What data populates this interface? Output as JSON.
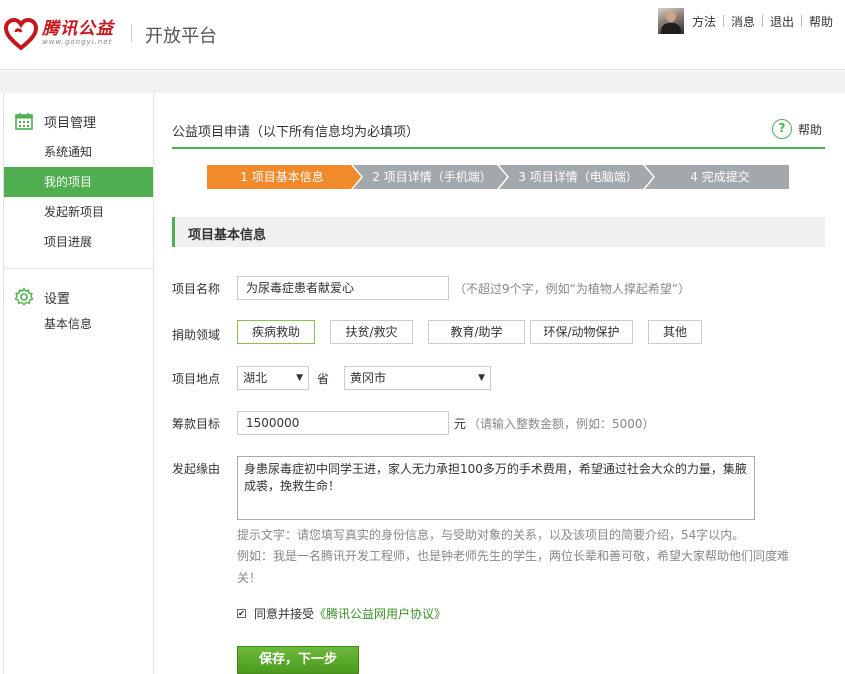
{
  "header": {
    "brand_name": "腾讯公益",
    "brand_url": "www.gongyi.net",
    "platform_title": "开放平台",
    "nav": {
      "user_name": "方法",
      "messages": "消息",
      "logout": "退出",
      "help": "帮助"
    }
  },
  "sidebar": {
    "project_mgmt": {
      "heading": "项目管理",
      "icon": "calendar-icon",
      "items": [
        {
          "label": "系统通知",
          "active": false
        },
        {
          "label": "我的项目",
          "active": true
        },
        {
          "label": "发起新项目",
          "active": false
        },
        {
          "label": "项目进展",
          "active": false
        }
      ]
    },
    "settings": {
      "heading": "设置",
      "icon": "gear-icon",
      "items": [
        {
          "label": "基本信息",
          "active": false
        }
      ]
    }
  },
  "main": {
    "page_title": "公益项目申请（以下所有信息均为必填项）",
    "help_label": "帮助",
    "steps": [
      {
        "label": "1 项目基本信息",
        "active": true
      },
      {
        "label": "2 项目详情（手机端）",
        "active": false
      },
      {
        "label": "3 项目详情（电脑端）",
        "active": false
      },
      {
        "label": "4 完成提交",
        "active": false
      }
    ],
    "section_title": "项目基本信息",
    "form": {
      "name_label": "项目名称",
      "name_value": "为尿毒症患者献爱心",
      "name_hint": "（不超过9个字，例如“为植物人撑起希望”）",
      "field_label": "捐助领域",
      "fields": [
        {
          "label": "疾病救助",
          "selected": true
        },
        {
          "label": "扶贫/救灾",
          "selected": false
        },
        {
          "label": "教育/助学",
          "selected": false
        },
        {
          "label": "环保/动物保护",
          "selected": false
        },
        {
          "label": "其他",
          "selected": false
        }
      ],
      "location_label": "项目地点",
      "province_value": "湖北",
      "province_suffix": "省",
      "city_value": "黄冈市",
      "goal_label": "筹款目标",
      "goal_value": "1500000",
      "goal_unit": "元",
      "goal_hint": "（请输入整数金额，例如：5000）",
      "reason_label": "发起缘由",
      "reason_value": "身患尿毒症初中同学王进，家人无力承担100多万的手术费用，希望通过社会大众的力量，集腋成裘，挽救生命！",
      "tip_line1": "提示文字：请您填写真实的身份信息，与受助对象的关系，以及该项目的简要介绍，54字以内。",
      "tip_line2": "例如：我是一名腾讯开发工程师，也是钟老师先生的学生，两位长辈和善可敬，希望大家帮助他们同度难关！",
      "agree_prefix": "同意并接受",
      "agree_link": "《腾讯公益网用户协议》",
      "agree_checked": true,
      "submit_label": "保存，下一步"
    }
  },
  "colors": {
    "brand_red": "#c8161d",
    "accent_green": "#4fae4e",
    "step_active": "#f08a2b",
    "step_inactive": "#a3a8ac"
  }
}
